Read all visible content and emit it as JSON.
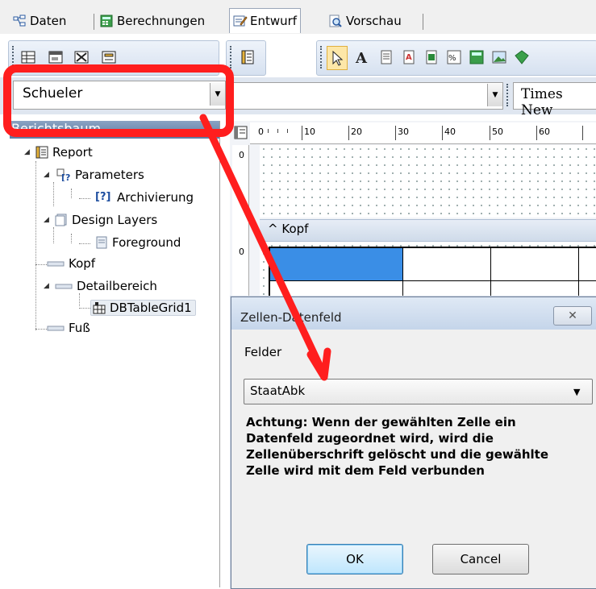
{
  "tabs": [
    {
      "label": "Daten"
    },
    {
      "label": "Berechnungen"
    },
    {
      "label": "Entwurf",
      "active": true
    },
    {
      "label": "Vorschau"
    }
  ],
  "report_select": {
    "value": "Schueler"
  },
  "font_select": {
    "value": "Times New"
  },
  "tree": {
    "header": "Berichtsbaum",
    "nodes": {
      "report": "Report",
      "parameters": "Parameters",
      "archivierung": "Archivierung",
      "design_layers": "Design Layers",
      "foreground": "Foreground",
      "kopf": "Kopf",
      "detailbereich": "Detailbereich",
      "dbtablegrid": "DBTableGrid1",
      "fuss": "Fuß"
    }
  },
  "ruler": {
    "labels": [
      "0",
      "10",
      "20",
      "30",
      "40",
      "50",
      "60"
    ],
    "left_zero_top": "0",
    "left_zero_mid": "0"
  },
  "band": {
    "kopf": "Kopf",
    "caret": "^"
  },
  "dialog": {
    "title": "Zellen-Datenfeld",
    "close_symbol": "✕",
    "fields_label": "Felder",
    "fields_value": "StaatAbk",
    "warning": "Achtung: Wenn der gewählten Zelle ein Datenfeld zugeordnet wird, wird die Zellenüberschrift gelöscht und die gewählte Zelle wird mit dem Feld verbunden",
    "ok_label": "OK",
    "cancel_label": "Cancel"
  },
  "colors": {
    "highlight": "#ff1e1e",
    "selected_cell": "#3a8ee6"
  }
}
